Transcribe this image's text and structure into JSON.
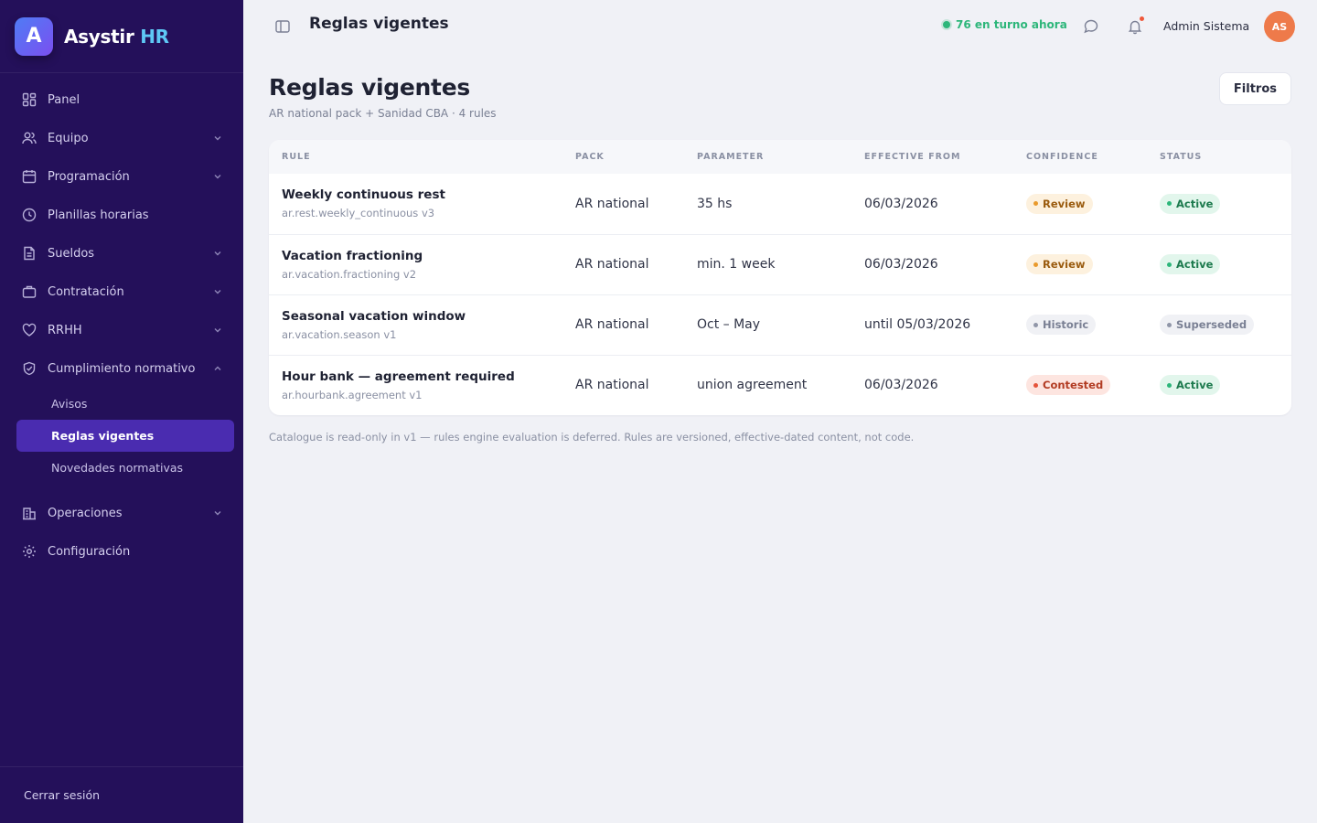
{
  "brand": {
    "logo_letter": "A",
    "name": "Asystir",
    "accent": "HR"
  },
  "sidebar": {
    "items": [
      {
        "label": "Panel",
        "icon": "grid-icon"
      },
      {
        "label": "Equipo",
        "icon": "users-icon"
      },
      {
        "label": "Programación",
        "icon": "calendar-icon"
      },
      {
        "label": "Planillas horarias",
        "icon": "clock-icon"
      },
      {
        "label": "Sueldos",
        "icon": "document-icon"
      },
      {
        "label": "Contratación",
        "icon": "briefcase-icon"
      },
      {
        "label": "RRHH",
        "icon": "heart-icon"
      },
      {
        "label": "Cumplimiento normativo",
        "icon": "shield-icon"
      },
      {
        "label": "Operaciones",
        "icon": "building-icon"
      },
      {
        "label": "Configuración",
        "icon": "gear-icon"
      }
    ],
    "sub_items": [
      {
        "label": "Avisos"
      },
      {
        "label": "Reglas vigentes"
      },
      {
        "label": "Novedades normativas"
      }
    ],
    "logout": "Cerrar sesión"
  },
  "topbar": {
    "title": "Reglas vigentes",
    "shift_status": "76 en turno ahora",
    "user_name": "Admin Sistema",
    "avatar_initials": "AS"
  },
  "page": {
    "title": "Reglas vigentes",
    "subtitle": "AR national pack + Sanidad CBA · 4 rules",
    "filters_label": "Filtros",
    "footnote": "Catalogue is read-only in v1 — rules engine evaluation is deferred. Rules are versioned, effective-dated content, not code."
  },
  "table": {
    "headers": [
      "RULE",
      "PACK",
      "PARAMETER",
      "EFFECTIVE FROM",
      "CONFIDENCE",
      "STATUS"
    ],
    "rows": [
      {
        "name": "Weekly continuous rest",
        "id": "ar.rest.weekly_continuous v3",
        "pack": "AR national",
        "parameter": "35 hs",
        "effective": "06/03/2026",
        "confidence": "Review",
        "status": "Active"
      },
      {
        "name": "Vacation fractioning",
        "id": "ar.vacation.fractioning v2",
        "pack": "AR national",
        "parameter": "min. 1 week",
        "effective": "06/03/2026",
        "confidence": "Review",
        "status": "Active"
      },
      {
        "name": "Seasonal vacation window",
        "id": "ar.vacation.season v1",
        "pack": "AR national",
        "parameter": "Oct – May",
        "effective": "until 05/03/2026",
        "confidence": "Historic",
        "status": "Superseded"
      },
      {
        "name": "Hour bank — agreement required",
        "id": "ar.hourbank.agreement v1",
        "pack": "AR national",
        "parameter": "union agreement",
        "effective": "06/03/2026",
        "confidence": "Contested",
        "status": "Active"
      }
    ]
  },
  "colors": {
    "sidebar_bg": "#24105a",
    "active_item": "#4a2cb0",
    "brand_accent": "#5ec8f5",
    "online_green": "#2db67a",
    "avatar": "#ee7a4a"
  }
}
